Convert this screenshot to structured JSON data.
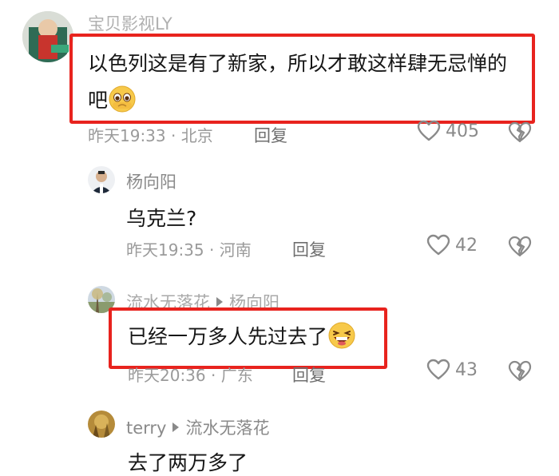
{
  "comments": [
    {
      "name": "宝贝影视LY",
      "text_line1": "以色列这是有了新家，所以才敢这样肆无忌惮的",
      "text_line2": "吧",
      "time": "昨天19:33",
      "location": "北京",
      "reply_label": "回复",
      "likes": "405"
    },
    {
      "name": "杨向阳",
      "text": "乌克兰?",
      "time": "昨天19:35",
      "location": "河南",
      "reply_label": "回复",
      "likes": "42"
    },
    {
      "name": "流水无落花",
      "reply_to": "杨向阳",
      "text": "已经一万多人先过去了",
      "time": "昨天20:36",
      "location": "广东",
      "reply_label": "回复",
      "likes": "43"
    },
    {
      "name": "terry",
      "reply_to": "流水无落花",
      "text": "去了两万多了"
    }
  ],
  "colors": {
    "highlight": "#e8231e",
    "meta_text": "#9a9a9a"
  },
  "icons": [
    "heart-outline-icon",
    "broken-heart-icon",
    "pleading-face-emoji",
    "laughing-face-emoji",
    "reply-arrow-icon"
  ]
}
